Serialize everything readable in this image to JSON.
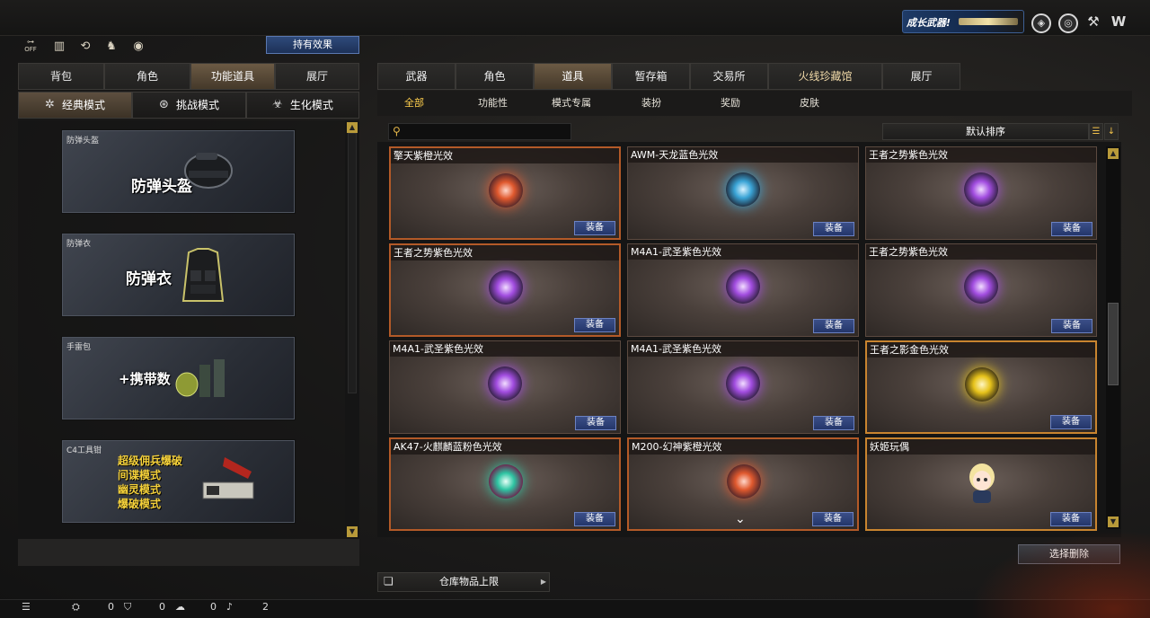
{
  "top": {
    "promo_label": "成长武器!",
    "icons": [
      "shield-icon",
      "globe-icon",
      "wrench-icon",
      "brand-icon"
    ]
  },
  "left": {
    "icons": [
      "sound-toggle-icon",
      "stats-icon",
      "refresh-icon",
      "character-icon",
      "egg-icon"
    ],
    "sound_state": "OFF",
    "hold_effect_label": "持有效果",
    "tabs": [
      {
        "label": "背包",
        "active": false
      },
      {
        "label": "角色",
        "active": false
      },
      {
        "label": "功能道具",
        "active": true
      },
      {
        "label": "展厅",
        "active": false
      }
    ],
    "modes": [
      {
        "label": "经典模式",
        "icon": "star-icon",
        "active": true
      },
      {
        "label": "挑战模式",
        "icon": "target-icon",
        "active": false
      },
      {
        "label": "生化模式",
        "icon": "biohazard-icon",
        "active": false
      }
    ],
    "cards": [
      {
        "caption": "防弹头盔",
        "big": "防弹头盔"
      },
      {
        "caption": "防弹衣",
        "big": "防弹衣"
      },
      {
        "caption": "手雷包",
        "big": "+携带数"
      },
      {
        "caption": "C4工具钳",
        "lines": [
          "超级佣兵爆破",
          "间谍模式",
          "幽灵模式",
          "爆破模式"
        ]
      }
    ]
  },
  "right": {
    "tabs": [
      {
        "label": "武器",
        "active": false
      },
      {
        "label": "角色",
        "active": false
      },
      {
        "label": "道具",
        "active": true
      },
      {
        "label": "暂存箱",
        "active": false
      },
      {
        "label": "交易所",
        "active": false
      },
      {
        "label": "火线珍藏馆",
        "active": false
      },
      {
        "label": "展厅",
        "active": false
      }
    ],
    "filters": [
      {
        "label": "全部",
        "active": true
      },
      {
        "label": "功能性",
        "active": false
      },
      {
        "label": "模式专属",
        "active": false
      },
      {
        "label": "装扮",
        "active": false
      },
      {
        "label": "奖励",
        "active": false
      },
      {
        "label": "皮肤",
        "active": false
      }
    ],
    "search_placeholder": "",
    "sort_label": "默认排序",
    "equip_label": "装备",
    "items": [
      {
        "title": "擎天紫橙光效",
        "color": "orange"
      },
      {
        "title": "AWM-天龙蓝色光效",
        "color": "blue"
      },
      {
        "title": "王者之势紫色光效",
        "color": "purple"
      },
      {
        "title": "王者之势紫色光效",
        "color": "purple"
      },
      {
        "title": "M4A1-武圣紫色光效",
        "color": "purple"
      },
      {
        "title": "王者之势紫色光效",
        "color": "purple"
      },
      {
        "title": "M4A1-武圣紫色光效",
        "color": "purple"
      },
      {
        "title": "M4A1-武圣紫色光效",
        "color": "purple"
      },
      {
        "title": "王者之影金色光效",
        "color": "gold"
      },
      {
        "title": "AK47-火麒麟蓝粉色光效",
        "color": "teal"
      },
      {
        "title": "M200-幻神紫橙光效",
        "color": "orange"
      },
      {
        "title": "妖姬玩偶",
        "color": "doll"
      }
    ],
    "remove_label": "选择删除",
    "storage_label": "仓库物品上限"
  },
  "status": {
    "counts": [
      "0",
      "0",
      "0",
      "2"
    ],
    "icons": [
      "list-icon",
      "binoculars-icon",
      "shield-icon",
      "chat-icon",
      "speaker-icon"
    ]
  }
}
